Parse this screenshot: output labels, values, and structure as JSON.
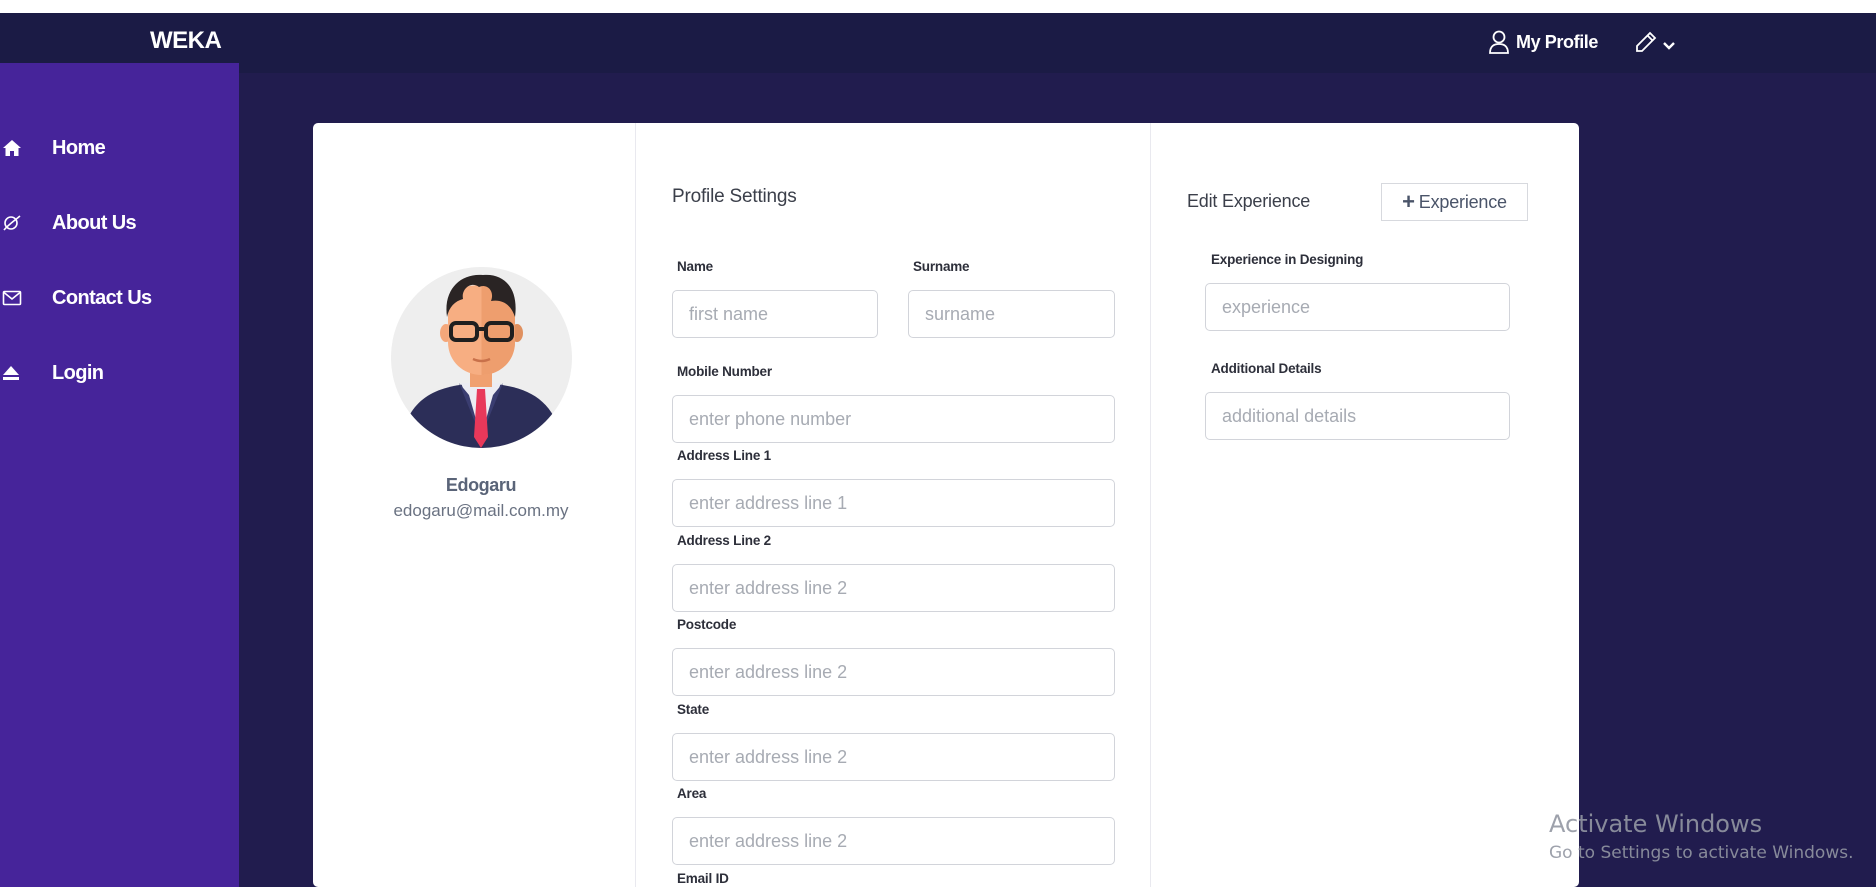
{
  "brand": "WEKA",
  "header": {
    "profile_label": "My Profile"
  },
  "sidebar": {
    "items": [
      {
        "label": "Home",
        "icon": "home-icon"
      },
      {
        "label": "About Us",
        "icon": "about-icon"
      },
      {
        "label": "Contact Us",
        "icon": "envelope-icon"
      },
      {
        "label": "Login",
        "icon": "eject-icon"
      }
    ]
  },
  "user": {
    "name": "Edogaru",
    "email": "edogaru@mail.com.my"
  },
  "profile_settings": {
    "title": "Profile Settings",
    "fields": {
      "name": {
        "label": "Name",
        "placeholder": "first name"
      },
      "surname": {
        "label": "Surname",
        "placeholder": "surname"
      },
      "mobile": {
        "label": "Mobile Number",
        "placeholder": "enter phone number"
      },
      "address1": {
        "label": "Address Line 1",
        "placeholder": "enter address line 1"
      },
      "address2": {
        "label": "Address Line 2",
        "placeholder": "enter address line 2"
      },
      "postcode": {
        "label": "Postcode",
        "placeholder": "enter address line 2"
      },
      "state": {
        "label": "State",
        "placeholder": "enter address line 2"
      },
      "area": {
        "label": "Area",
        "placeholder": "enter address line 2"
      },
      "email": {
        "label": "Email ID"
      }
    }
  },
  "experience": {
    "title": "Edit Experience",
    "add_button_label": "Experience",
    "fields": {
      "designing": {
        "label": "Experience in Designing",
        "placeholder": "experience"
      },
      "additional": {
        "label": "Additional Details",
        "placeholder": "additional details"
      }
    }
  },
  "watermark": {
    "title": "Activate Windows",
    "subtitle": "Go to Settings to activate Windows."
  },
  "colors": {
    "topbar": "#1b1b45",
    "background": "#211c4e",
    "sidebar": "#46249a",
    "card": "#ffffff",
    "tie": "#e8385a"
  }
}
